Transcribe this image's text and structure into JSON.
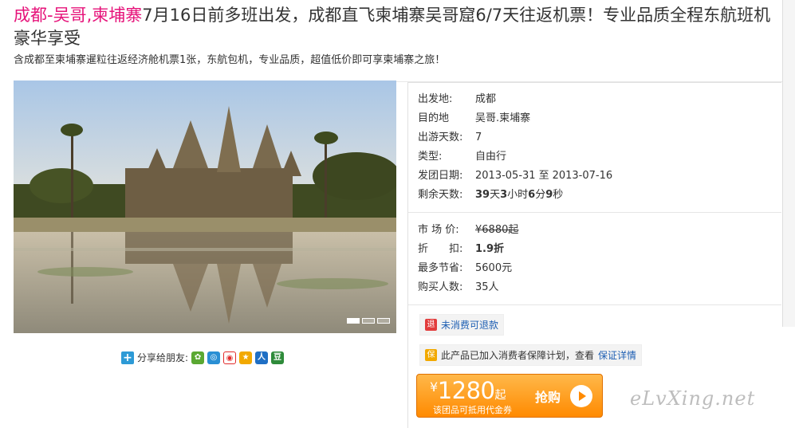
{
  "title": {
    "highlight": "成都-吴哥,柬埔寨",
    "rest": "7月16日前多班出发，成都直飞柬埔寨吴哥窟6/7天往返机票！专业品质全程东航班机豪华享受"
  },
  "subtitle": "含成都至柬埔寨暹粒往返经济舱机票1张，东航包机，专业品质，超值低价即可享柬埔寨之旅！",
  "share": {
    "label": "分享给朋友:",
    "icons": [
      "kaixin-icon",
      "qzone-icon",
      "weibo-icon",
      "star-icon",
      "renren-icon",
      "douban-icon"
    ]
  },
  "details": {
    "departure_label": "出发地:",
    "departure_value": "成都",
    "destination_label": "目的地",
    "destination_value": "吴哥.柬埔寨",
    "days_label": "出游天数:",
    "days_value": "7",
    "type_label": "类型:",
    "type_value": "自由行",
    "dates_label": "发团日期:",
    "date_start": "2013-05-31",
    "date_to": "至",
    "date_end": "2013-07-16",
    "remaining_label": "剩余天数:",
    "remaining_days": "39",
    "remaining_days_unit": "天",
    "remaining_hours": "3",
    "remaining_hours_unit": "小时",
    "remaining_minutes": "6",
    "remaining_minutes_unit": "分",
    "remaining_seconds": "9",
    "remaining_seconds_unit": "秒"
  },
  "pricing": {
    "market_label": "市 场 价:",
    "market_value": "¥6880起",
    "discount_label": "折　　扣:",
    "discount_value": "1.9折",
    "saving_label": "最多节省:",
    "saving_value": "5600元",
    "buyers_label": "购买人数:",
    "buyers_value": "35人"
  },
  "refund_badge": {
    "icon": "退",
    "text": "未消费可退款"
  },
  "guarantee_badge": {
    "icon": "保",
    "text": "此产品已加入消费者保障计划，查看",
    "link": "保证详情"
  },
  "buy": {
    "currency": "¥",
    "price": "1280",
    "suffix": "起",
    "note": "该团品可抵用代金券",
    "button": "抢购"
  },
  "watermark": "eLvXing.net",
  "colors": {
    "accent_pink": "#e6137a",
    "date_green": "#2f8f2f",
    "buy_orange": "#ff8a00",
    "link_blue": "#1e5fb3"
  }
}
